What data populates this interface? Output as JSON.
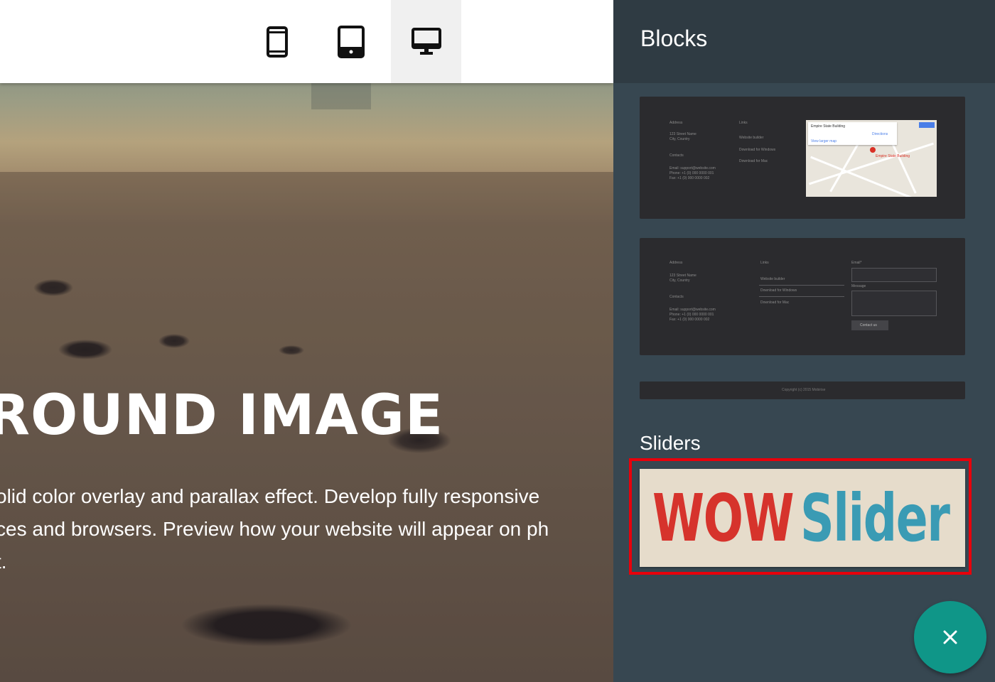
{
  "toolbar": {
    "devices": [
      {
        "name": "mobile",
        "icon": "phone-icon",
        "active": false
      },
      {
        "name": "tablet",
        "icon": "tablet-icon",
        "active": false
      },
      {
        "name": "desktop",
        "icon": "desktop-monitor-icon",
        "active": true
      }
    ]
  },
  "hero": {
    "title": "ROUND IMAGE",
    "text_line1": "olid color overlay and parallax effect. Develop fully responsive",
    "text_line2": "ces and browsers. Preview how your website will appear on ph",
    "text_line3": "t."
  },
  "panel": {
    "title": "Blocks",
    "sliders_label": "Sliders",
    "blocks": [
      {
        "name": "footer-with-map",
        "col1": [
          "Address",
          "123 Street Name",
          "City, Country",
          "Contacts",
          "Email: support@website.com",
          "Phone: +1 (0) 000 0000 001",
          "Fax: +1 (0) 000 0000 002"
        ],
        "col2": [
          "Links",
          "Website builder",
          "Download for Windows",
          "Download for Mac"
        ],
        "map": {
          "place": "Empire State Building",
          "link": "View larger map",
          "badge": "Directions",
          "marker": "Empire State Building"
        }
      },
      {
        "name": "footer-with-form",
        "col1": [
          "Address",
          "123 Street Name",
          "City, Country",
          "Contacts",
          "Email: support@website.com",
          "Phone: +1 (0) 000 0000 001",
          "Fax: +1 (0) 000 0000 002"
        ],
        "col2": [
          "Links",
          "Website builder",
          "Download for Windows",
          "Download for Mac"
        ],
        "form": {
          "email_label": "Email*",
          "message_label": "Message",
          "button": "Contact us"
        }
      },
      {
        "name": "copyright-strip",
        "text": "Copyright (c) 2015 Mobirise"
      }
    ],
    "slider_thumb": {
      "word1": "WOW",
      "word2": "Slider"
    }
  },
  "fab": {
    "icon": "close-icon"
  },
  "colors": {
    "panel_bg": "#374751",
    "panel_header": "#2f3b43",
    "fab": "#0f9688",
    "highlight": "#e8000b",
    "wow_red": "#d6332c",
    "wow_blue": "#3a9bb4"
  }
}
